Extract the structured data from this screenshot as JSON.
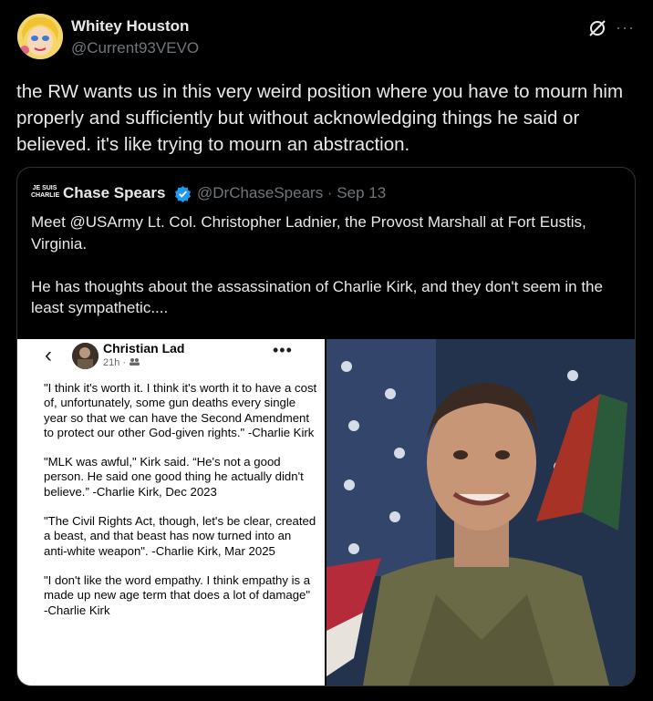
{
  "tweet": {
    "author_name": "Whitey Houston",
    "author_handle": "@Current93VEVO",
    "text": "the RW wants us in this very weird position where you have to mourn him properly and sufficiently but without acknowledging things he said or believed. it's like trying to mourn an abstraction.",
    "more_label": "···",
    "icons": [
      "avatar",
      "grok-icon",
      "more-icon"
    ]
  },
  "quote": {
    "badge": "JE SUIS CHARLIE",
    "author_name": "Chase Spears",
    "handle_date": "@DrChaseSpears · Sep 13",
    "text": "Meet @USArmy Lt. Col. Christopher Ladnier, the Provost Marshall at Fort Eustis, Virginia.\n\nHe has thoughts about the assassination of Charlie Kirk, and they don't seem in the least sympathetic....",
    "verified_color": "#1d9bf0"
  },
  "embedded_post": {
    "back_icon": "‹",
    "poster_name": "Christian Lad",
    "meta": "21h ·",
    "more_label": "•••",
    "paragraphs": [
      "\"I think it's worth it. I think it's worth it to have a cost of, unfortunately, some gun deaths every single year so that we can have the Second Amendment to protect our other God-given rights.\" -Charlie Kirk",
      "\"MLK was awful,\" Kirk said. “He's not a good person. He said one good thing he actually didn't believe.” -Charlie Kirk, Dec 2023",
      "\"The Civil Rights Act, though, let's be clear, created a beast, and that beast has now turned into an anti-white weapon\". -Charlie Kirk, Mar 2025",
      "\"I don't like the word empathy. I think empathy is a made up new age term that does a lot of damage\" -Charlie Kirk"
    ]
  },
  "colors": {
    "background": "#000000",
    "text": "#e7e9ea",
    "secondary_text": "#71767b",
    "border": "#2f3336"
  }
}
